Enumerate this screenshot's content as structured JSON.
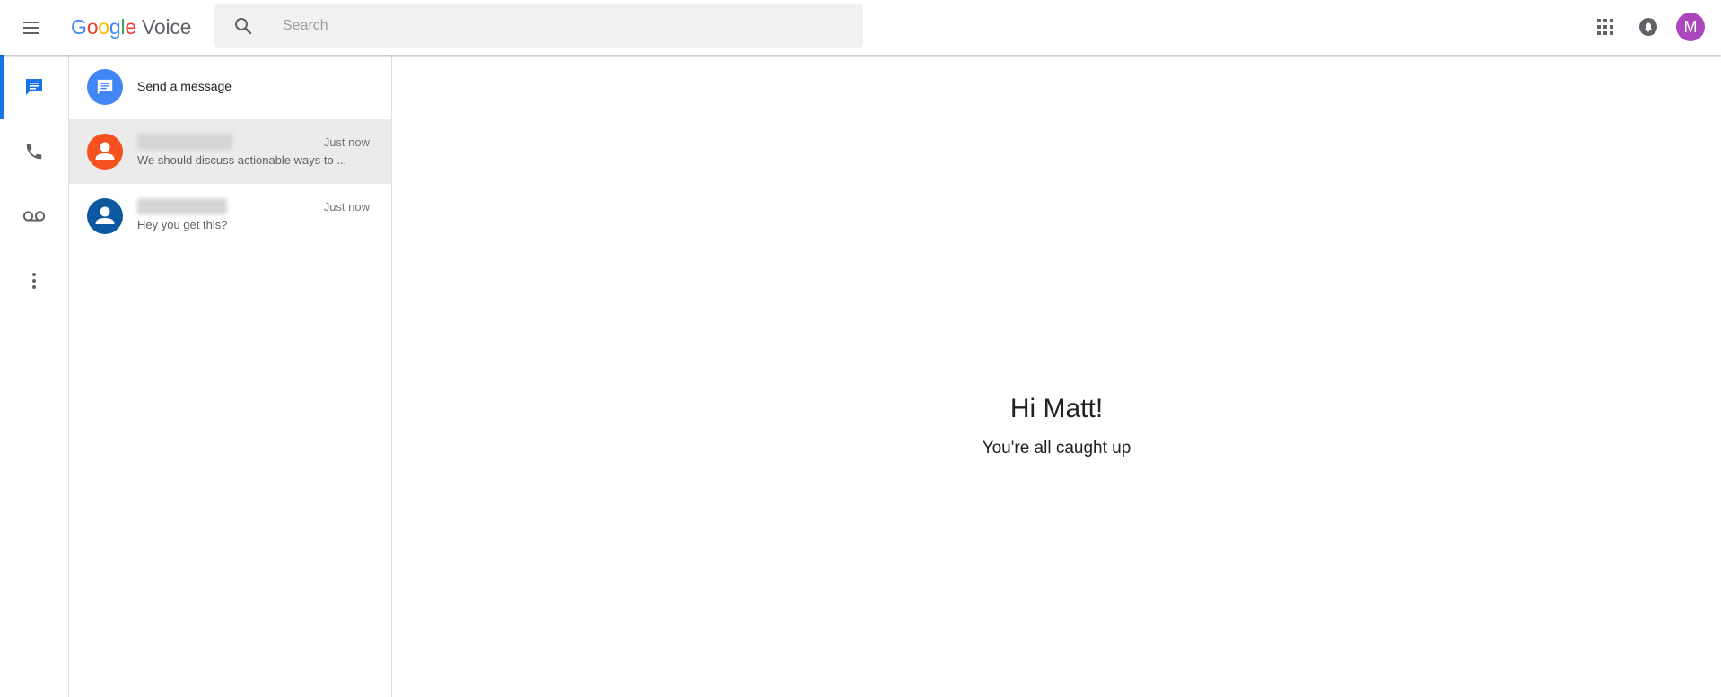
{
  "header": {
    "logo_letters": [
      "G",
      "o",
      "o",
      "g",
      "l",
      "e"
    ],
    "product_name": "Voice",
    "search_placeholder": "Search",
    "account_initial": "M"
  },
  "nav": {
    "items": [
      {
        "name": "messages",
        "active": true
      },
      {
        "name": "calls",
        "active": false
      },
      {
        "name": "voicemail",
        "active": false
      },
      {
        "name": "more",
        "active": false
      }
    ]
  },
  "thread_list": {
    "send_message_label": "Send a message",
    "threads": [
      {
        "contact_name": "",
        "time": "Just now",
        "snippet": "We should discuss actionable ways to ...",
        "avatar_color": "#f4511e",
        "selected": true
      },
      {
        "contact_name": "",
        "time": "Just now",
        "snippet": "Hey you get this?",
        "avatar_color": "#0b57a0",
        "selected": false
      }
    ]
  },
  "main": {
    "greeting": "Hi Matt!",
    "status": "You're all caught up"
  },
  "colors": {
    "accent": "#1a73e8",
    "send_button": "#4285f4",
    "account_avatar": "#ab47bc",
    "selected_row": "#ebebeb"
  }
}
